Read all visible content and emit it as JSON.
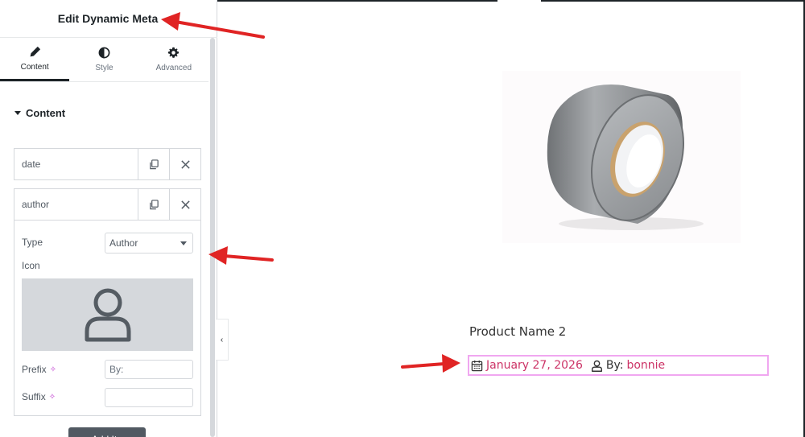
{
  "panel": {
    "title": "Edit Dynamic Meta",
    "tabs": [
      {
        "label": "Content",
        "icon": "pencil-icon",
        "active": true
      },
      {
        "label": "Style",
        "icon": "half-circle-icon",
        "active": false
      },
      {
        "label": "Advanced",
        "icon": "gear-icon",
        "active": false
      }
    ],
    "section_title": "Content",
    "items": [
      {
        "label": "date"
      },
      {
        "label": "author"
      }
    ],
    "item_fields": {
      "type_label": "Type",
      "type_value": "Author",
      "icon_label": "Icon",
      "icon_preview": "user-icon",
      "prefix_label": "Prefix",
      "prefix_value": "By:",
      "suffix_label": "Suffix",
      "suffix_value": ""
    },
    "add_item_label": "+ Add Item",
    "collapse_glyph": "‹"
  },
  "preview": {
    "product_image": "duct-tape-roll",
    "product_name": "Product Name 2",
    "meta": {
      "date": "January 27, 2026",
      "prefix": "By:",
      "author": "bonnie"
    }
  },
  "colors": {
    "accent_link": "#cc3366",
    "annotation_arrow": "#e02424",
    "meta_border": "#f0a7f0",
    "dynamic_tag": "#c13fd0"
  }
}
